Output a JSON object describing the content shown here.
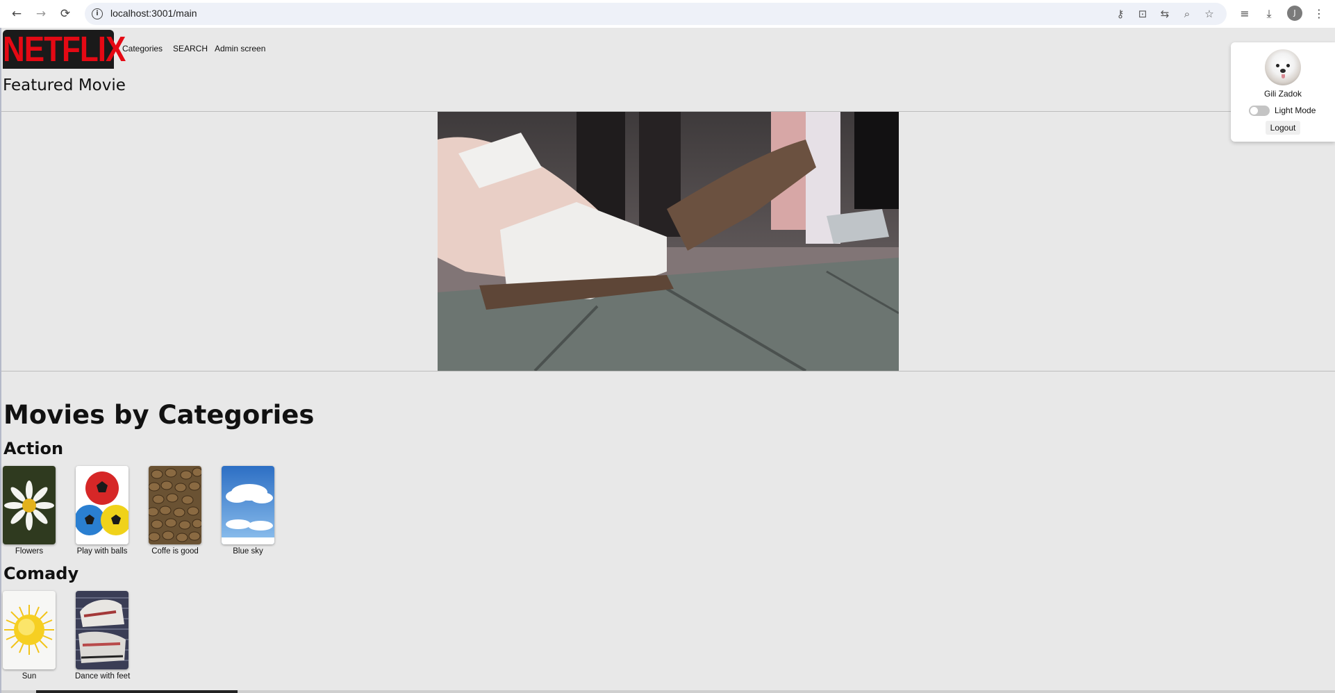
{
  "browser": {
    "url": "localhost:3001/main",
    "back_icon": "←",
    "forward_icon": "→",
    "reload_icon": "⟳",
    "info_icon": "i",
    "profile_initial": "J"
  },
  "nav": {
    "logo_text": "NETFLIX",
    "links": [
      "Categories",
      "SEARCH",
      "Admin screen"
    ]
  },
  "featured": {
    "title": "Featured Movie"
  },
  "categories_section": {
    "heading": "Movies by Categories",
    "categories": [
      {
        "name": "Action",
        "movies": [
          {
            "title": "Flowers",
            "image": "daisy-flower"
          },
          {
            "title": "Play with balls",
            "image": "three-balls"
          },
          {
            "title": "Coffe is good",
            "image": "coffee-beans"
          },
          {
            "title": "Blue sky",
            "image": "sky-clouds"
          }
        ]
      },
      {
        "name": "Comady",
        "movies": [
          {
            "title": "Sun",
            "image": "sun"
          },
          {
            "title": "Dance with feet",
            "image": "sneakers"
          }
        ]
      }
    ]
  },
  "profile_menu": {
    "user_name": "Gili Zadok",
    "mode_label": "Light Mode",
    "logout_label": "Logout"
  },
  "colors": {
    "brand": "#e50914",
    "page_bg": "#e8e8e8"
  }
}
